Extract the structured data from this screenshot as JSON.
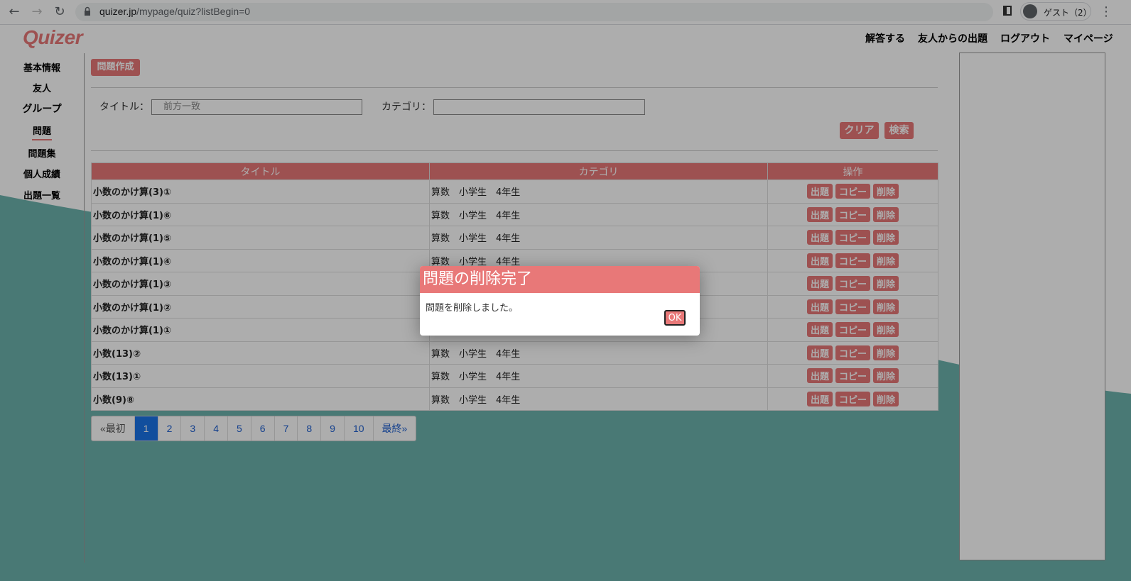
{
  "browser": {
    "url_host": "quizer.jp",
    "url_path": "/mypage/quiz?listBegin=0",
    "profile_label": "ゲスト（2）"
  },
  "header": {
    "logo": "Quizer",
    "nav": [
      "解答する",
      "友人からの出題",
      "ログアウト",
      "マイページ"
    ]
  },
  "sidebar": {
    "items": [
      "基本情報",
      "友人",
      "グループ",
      "問題",
      "問題集",
      "個人成績",
      "出題一覧"
    ],
    "active": "問題"
  },
  "toolbar": {
    "create_label": "問題作成"
  },
  "search": {
    "title_label": "タイトル：",
    "title_placeholder": "前方一致",
    "category_label": "カテゴリ：",
    "category_value": "",
    "clear_label": "クリア",
    "search_label": "検索"
  },
  "table": {
    "headers": [
      "タイトル",
      "カテゴリ",
      "操作"
    ],
    "op_labels": [
      "出題",
      "コピー",
      "削除"
    ],
    "rows": [
      {
        "title": "小数のかけ算(3)①",
        "category": "算数　小学生　4年生"
      },
      {
        "title": "小数のかけ算(1)⑥",
        "category": "算数　小学生　4年生"
      },
      {
        "title": "小数のかけ算(1)⑤",
        "category": "算数　小学生　4年生"
      },
      {
        "title": "小数のかけ算(1)④",
        "category": "算数　小学生　4年生"
      },
      {
        "title": "小数のかけ算(1)③",
        "category": ""
      },
      {
        "title": "小数のかけ算(1)②",
        "category": ""
      },
      {
        "title": "小数のかけ算(1)①",
        "category": ""
      },
      {
        "title": "小数(13)②",
        "category": "算数　小学生　4年生"
      },
      {
        "title": "小数(13)①",
        "category": "算数　小学生　4年生"
      },
      {
        "title": "小数(9)⑧",
        "category": "算数　小学生　4年生"
      }
    ]
  },
  "pagination": {
    "first": "«最初",
    "pages": [
      "1",
      "2",
      "3",
      "4",
      "5",
      "6",
      "7",
      "8",
      "9",
      "10"
    ],
    "current": "1",
    "last": "最終»"
  },
  "modal": {
    "title": "問題の削除完了",
    "message": "問題を削除しました。",
    "ok_label": "OK"
  },
  "colors": {
    "accent": "#e87878",
    "wave": "#6cb3ad",
    "link": "#1e5fd0"
  }
}
